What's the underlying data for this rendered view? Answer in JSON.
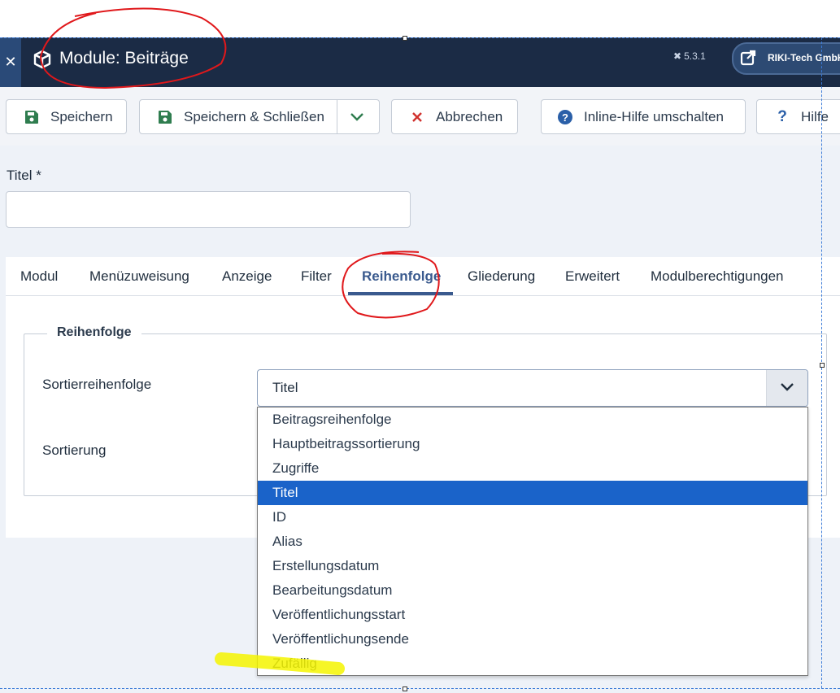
{
  "header": {
    "title": "Module: Beiträge",
    "version": "5.3.1",
    "user": "RIKI-Tech GmbH"
  },
  "toolbar": {
    "save": "Speichern",
    "save_close": "Speichern & Schließen",
    "cancel": "Abbrechen",
    "inline_help": "Inline-Hilfe umschalten",
    "help": "Hilfe"
  },
  "form": {
    "title_label": "Titel *",
    "title_value": ""
  },
  "tabs": [
    "Modul",
    "Menüzuweisung",
    "Anzeige",
    "Filter",
    "Reihenfolge",
    "Gliederung",
    "Erweitert",
    "Modulberechtigungen"
  ],
  "active_tab": "Reihenfolge",
  "ordering": {
    "legend": "Reihenfolge",
    "sort_order_label": "Sortierreihenfolge",
    "sort_order_value": "Titel",
    "direction_label": "Sortierung",
    "options": [
      "Beitragsreihenfolge",
      "Hauptbeitragssortierung",
      "Zugriffe",
      "Titel",
      "ID",
      "Alias",
      "Erstellungsdatum",
      "Bearbeitungsdatum",
      "Veröffentlichungsstart",
      "Veröffentlichungsende",
      "Zufällig"
    ],
    "selected_option": "Titel"
  },
  "colors": {
    "header_bg": "#1b2b45",
    "accent": "#3a5a8e",
    "selected_option_bg": "#1a63c9",
    "annotation_red": "#e0181b",
    "highlight_yellow": "#f5f500"
  }
}
